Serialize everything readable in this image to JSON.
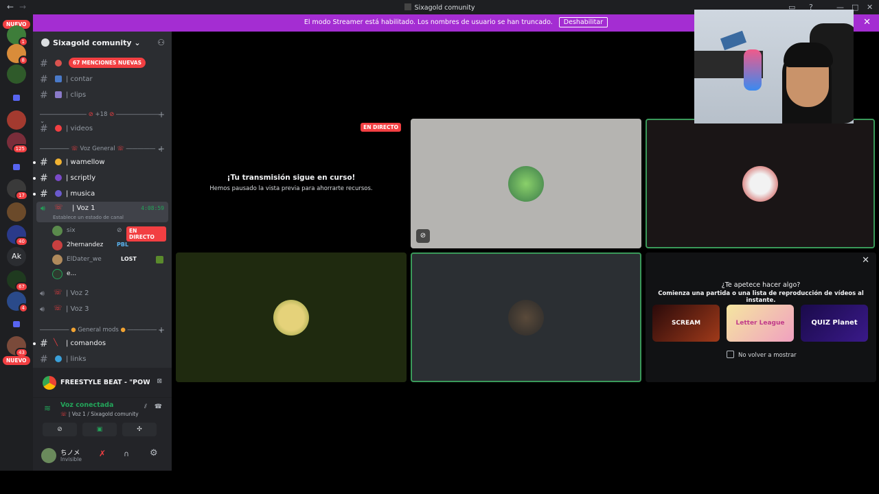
{
  "titlebar": {
    "title": "Sixagold comunity"
  },
  "banner": {
    "text": "El modo Streamer está habilitado. Los nombres de usuario se han truncado.",
    "button": "Deshabilitar"
  },
  "servers": {
    "new_label": "NUEVO",
    "badges": [
      "1",
      "8",
      "125",
      "17",
      "40",
      "67",
      "4",
      "43"
    ],
    "text_server": "Ak"
  },
  "guild": {
    "name": "Sixagold comunity",
    "mentions_pill": "67 MENCIONES NUEVAS"
  },
  "channels": [
    {
      "label": "| contar"
    },
    {
      "label": "| clips"
    },
    {
      "label": "| videos"
    },
    {
      "label": "| wamellow"
    },
    {
      "label": "| scriptly"
    },
    {
      "label": "| musica"
    },
    {
      "label": "| Voz 1"
    },
    {
      "label": "| Voz 2"
    },
    {
      "label": "| Voz 3"
    },
    {
      "label": "| comandos"
    },
    {
      "label": "| links"
    }
  ],
  "categories": {
    "nsfw": "+18",
    "voice": "Voz General",
    "mods": "General mods"
  },
  "voice1": {
    "timer": "4:08:59",
    "status_prompt": "Establece un estado de canal"
  },
  "voice_users": [
    {
      "name": "six",
      "tag": "EN DIRECTO",
      "avatar_color": "#5a8a4c"
    },
    {
      "name": "2hernandez",
      "tag": "PBL",
      "avatar_color": "#c94040"
    },
    {
      "name": "ElDater_we",
      "tag": "LOST",
      "avatar_color": "#b08a5c"
    },
    {
      "name": "e...",
      "tag": "",
      "avatar_color": "#2f3a2f"
    }
  ],
  "stream_card": {
    "app_title": "FREESTYLE BEAT - \"POWERFUL\" | ...",
    "status": "Voz conectada",
    "location": "| Voz 1 / Sixagold comunity",
    "user_name": "ちノメ",
    "user_status": "Invisible"
  },
  "main": {
    "live_badge": "EN DIRECTO",
    "paused_title": "¡Tu transmisión sigue en curso!",
    "paused_sub": "Hemos pausado la vista previa para ahorrarte recursos.",
    "activity_title": "¿Te apetece hacer algo?",
    "activity_sub": "Comienza una partida o una lista de reproducción de vídeos al instante.",
    "activity_cards": [
      "SCREAM",
      "Letter League",
      "QUIZ Planet"
    ],
    "dont_show": "No volver a mostrar"
  },
  "colors": {
    "accent": "#5865f2",
    "live": "#f23f42",
    "banner": "#a42dd2",
    "connected": "#23a55a"
  }
}
